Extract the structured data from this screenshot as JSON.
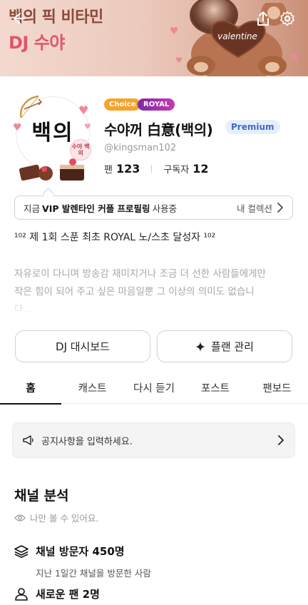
{
  "banner": {
    "line1": "백의 픽 비타민",
    "line2": "DJ 수야",
    "heart_text": "valentine"
  },
  "icons": {
    "back": "back-arrow-icon",
    "share": "share-icon",
    "settings": "gear-icon"
  },
  "profile": {
    "avatar_text": "백의",
    "avatar_sticker": "수야 백의",
    "badge_choice": "Choice",
    "badge_royal": "ROYAL",
    "name": "수야꺼 白意(백의)",
    "badge_premium": "Premium",
    "handle": "@kingsman102",
    "fans_label": "팬",
    "fans_count": "123",
    "subscribers_label": "구독자",
    "subscribers_count": "12"
  },
  "vip_bar": {
    "prefix": "지금",
    "bold": "VIP 발렌타인 커플 프로필링",
    "suffix": "사용중",
    "link": "내 컬렉션"
  },
  "intro": "¹⁰² 제 1회 스푼 최초 ROYAL 노/스초 달성자 ¹⁰²",
  "description": "자유로이 다니며 방송감 재미지거나 조금 더 선한 사람들에게만 작은 힘이 되어 주고 싶은 마음일뿐 그 이상의 의미도 없습니다....",
  "buttons": {
    "dashboard": "DJ 대시보드",
    "plan": "플랜 관리"
  },
  "tabs": [
    "홈",
    "캐스트",
    "다시 듣기",
    "포스트",
    "팬보드"
  ],
  "notice": {
    "placeholder": "공지사항을 입력하세요."
  },
  "analytics": {
    "title": "채널 분석",
    "visibility": "나만 볼 수 있어요.",
    "visitors": "채널 방문자 450명",
    "visitors_sub": "지난 1일간 채널을 방문한 사람",
    "new_fans": "새로운 팬 2명"
  },
  "colors": {
    "choice": "#f6a32a",
    "royal": "#9b30ad",
    "premium_text": "#3e6bc8",
    "banner_pink": "#e05569"
  }
}
